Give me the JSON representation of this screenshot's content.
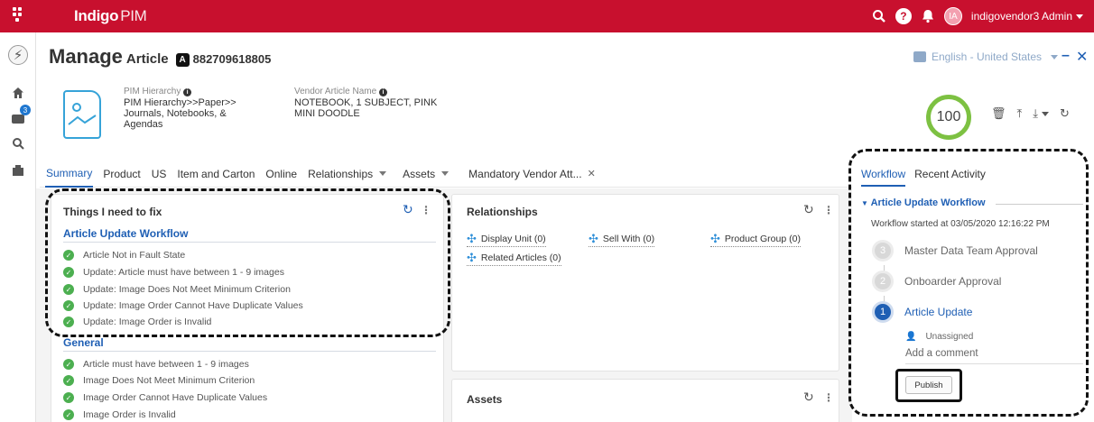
{
  "topbar": {
    "brand": "Indigo",
    "brand_suffix": "PIM",
    "user_initials": "IA",
    "user_name": "indigovendor3 Admin",
    "color": "#c8102e"
  },
  "header": {
    "title": "Manage",
    "subtitle": "Article",
    "type_badge": "A",
    "article_id": "882709618805",
    "language": "English - United States"
  },
  "fields": {
    "hierarchy_label": "PIM Hierarchy",
    "hierarchy_value_1": "PIM Hierarchy>>Paper>>",
    "hierarchy_value_2": "Journals, Notebooks, &",
    "hierarchy_value_3": "Agendas",
    "vendor_name_label": "Vendor Article Name",
    "vendor_name_value_1": "NOTEBOOK, 1 SUBJECT, PINK",
    "vendor_name_value_2": "MINI DOODLE"
  },
  "score": "100",
  "tabs": [
    "Summary",
    "Product",
    "US",
    "Item and Carton",
    "Online",
    "Relationships",
    "Assets",
    "Mandatory Vendor Att..."
  ],
  "fix_panel": {
    "title": "Things I need to fix",
    "section1": "Article Update Workflow",
    "items1": [
      "Article Not in Fault State",
      "Update: Article must have between 1 - 9 images",
      "Update: Image Does Not Meet Minimum Criterion",
      "Update: Image Order Cannot Have Duplicate Values",
      "Update: Image Order is Invalid"
    ],
    "section2": "General",
    "items2": [
      "Article must have between 1 - 9 images",
      "Image Does Not Meet Minimum Criterion",
      "Image Order Cannot Have Duplicate Values",
      "Image Order is Invalid"
    ]
  },
  "relationships": {
    "title": "Relationships",
    "links": [
      "Display Unit (0)",
      "Sell With (0)",
      "Product Group (0)",
      "Related Articles (0)"
    ]
  },
  "assets": {
    "title": "Assets"
  },
  "workflow": {
    "tabs": [
      "Workflow",
      "Recent Activity"
    ],
    "title": "Article Update Workflow",
    "started": "Workflow started at 03/05/2020 12:16:22 PM",
    "steps": [
      {
        "num": "3",
        "name": "Master Data Team Approval"
      },
      {
        "num": "2",
        "name": "Onboarder Approval"
      },
      {
        "num": "1",
        "name": "Article Update"
      }
    ],
    "assignee": "Unassigned",
    "comment_placeholder": "Add a comment",
    "publish": "Publish"
  }
}
